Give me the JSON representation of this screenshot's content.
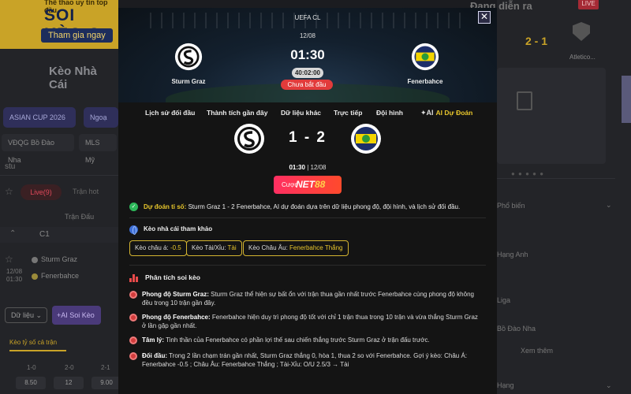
{
  "background": {
    "promo_title": "SOI KÈO C",
    "promo_top": "Thể thao uy tín top đầu",
    "promo_button": "Tham gia ngay",
    "heading": "Kèo Nhà Cái",
    "chips": [
      "ASIAN CUP 2026",
      "Ngoạ"
    ],
    "filters": [
      "VĐQG Bồ Đào Nha",
      "MLS Mỹ"
    ],
    "search_text": "stu",
    "live_label": "Live(9)",
    "schedule_label": "Trận hot",
    "column_header": "Trận Đấu",
    "league_code": "C1",
    "teams": [
      "Sturm Graz",
      "Fenerbahce"
    ],
    "date_line1": "12/08",
    "date_line2": "01:30",
    "data_button": "Dữ liệu",
    "ai_button": "+AI Soi Kèo",
    "odds_tab": "Kèo tỷ số cả trận",
    "odds_headers": [
      "1-0",
      "2-0",
      "2-1"
    ],
    "odds_values": [
      "8.50",
      "12",
      "9.00"
    ],
    "right_title": "Đang diễn ra",
    "right_live": "LIVE",
    "right_score": "2 - 1",
    "right_team": "Atletico...",
    "right_items": [
      "Phổ biến",
      "Hạng Anh",
      "Liga",
      "Bồ Đào Nha"
    ],
    "right_more": "Xem thêm",
    "right_last": "Hạng"
  },
  "modal": {
    "league": "UEFA CL",
    "close_label": "✕",
    "date": "12/08",
    "time": "01:30",
    "countdown": "40:02:00",
    "status": "Chưa bắt đầu",
    "home_team": "Sturm Graz",
    "away_team": "Fenerbahce",
    "tabs": [
      "Lịch sử đối đầu",
      "Thành tích gần đây",
      "Dữ liệu khác",
      "Trực tiếp",
      "Đội hình",
      "AI Dự Đoán"
    ],
    "ai_spark": "✦AI",
    "score": "1 - 2",
    "kickoff_time": "01:30",
    "kickoff_date": "| 12/08",
    "bet_small": "Cược",
    "bet_brand_a": "NET",
    "bet_brand_b": "88",
    "prediction_label": "Dự đoán tỉ số:",
    "prediction_text": "Sturm Graz 1 - 2 Fenerbahce, AI dự đoán dựa trên dữ liệu phong độ, đội hình, và lịch sử đối đầu.",
    "reference_title": "Kèo nhà cái tham khảo",
    "pills": [
      {
        "label": "Kèo châu á:",
        "value": "-0.5"
      },
      {
        "label": "Kèo Tài/Xỉu:",
        "value": "Tài"
      },
      {
        "label": "Kèo Châu Âu:",
        "value": "Fenerbahce Thắng"
      }
    ],
    "analysis_title": "Phân tích soi kèo",
    "analysis": [
      {
        "label": "Phong độ Sturm Graz:",
        "text": "Sturm Graz thể hiện sự bất ổn với trận thua gần nhất trước Fenerbahce cùng phong độ không đều trong 10 trận gần đây."
      },
      {
        "label": "Phong độ Fenerbahce:",
        "text": "Fenerbahce hiện duy trì phong độ tốt với chỉ 1 trận thua trong 10 trận và vừa thắng Sturm Graz ở lần gặp gần nhất."
      },
      {
        "label": "Tâm lý:",
        "text": "Tinh thần của Fenerbahce có phần lợi thế sau chiến thắng trước Sturm Graz ở trận đấu trước."
      },
      {
        "label": "Đối đầu:",
        "text": "Trong 2 lần chạm trán gần nhất, Sturm Graz thắng 0, hòa 1, thua 2 so với Fenerbahce. Gợi ý kèo: Châu Á: Fenerbahce -0.5 ; Châu Âu: Fenerbahce Thắng ; Tài-Xỉu: O/U 2.5/3 → Tài"
      }
    ]
  }
}
